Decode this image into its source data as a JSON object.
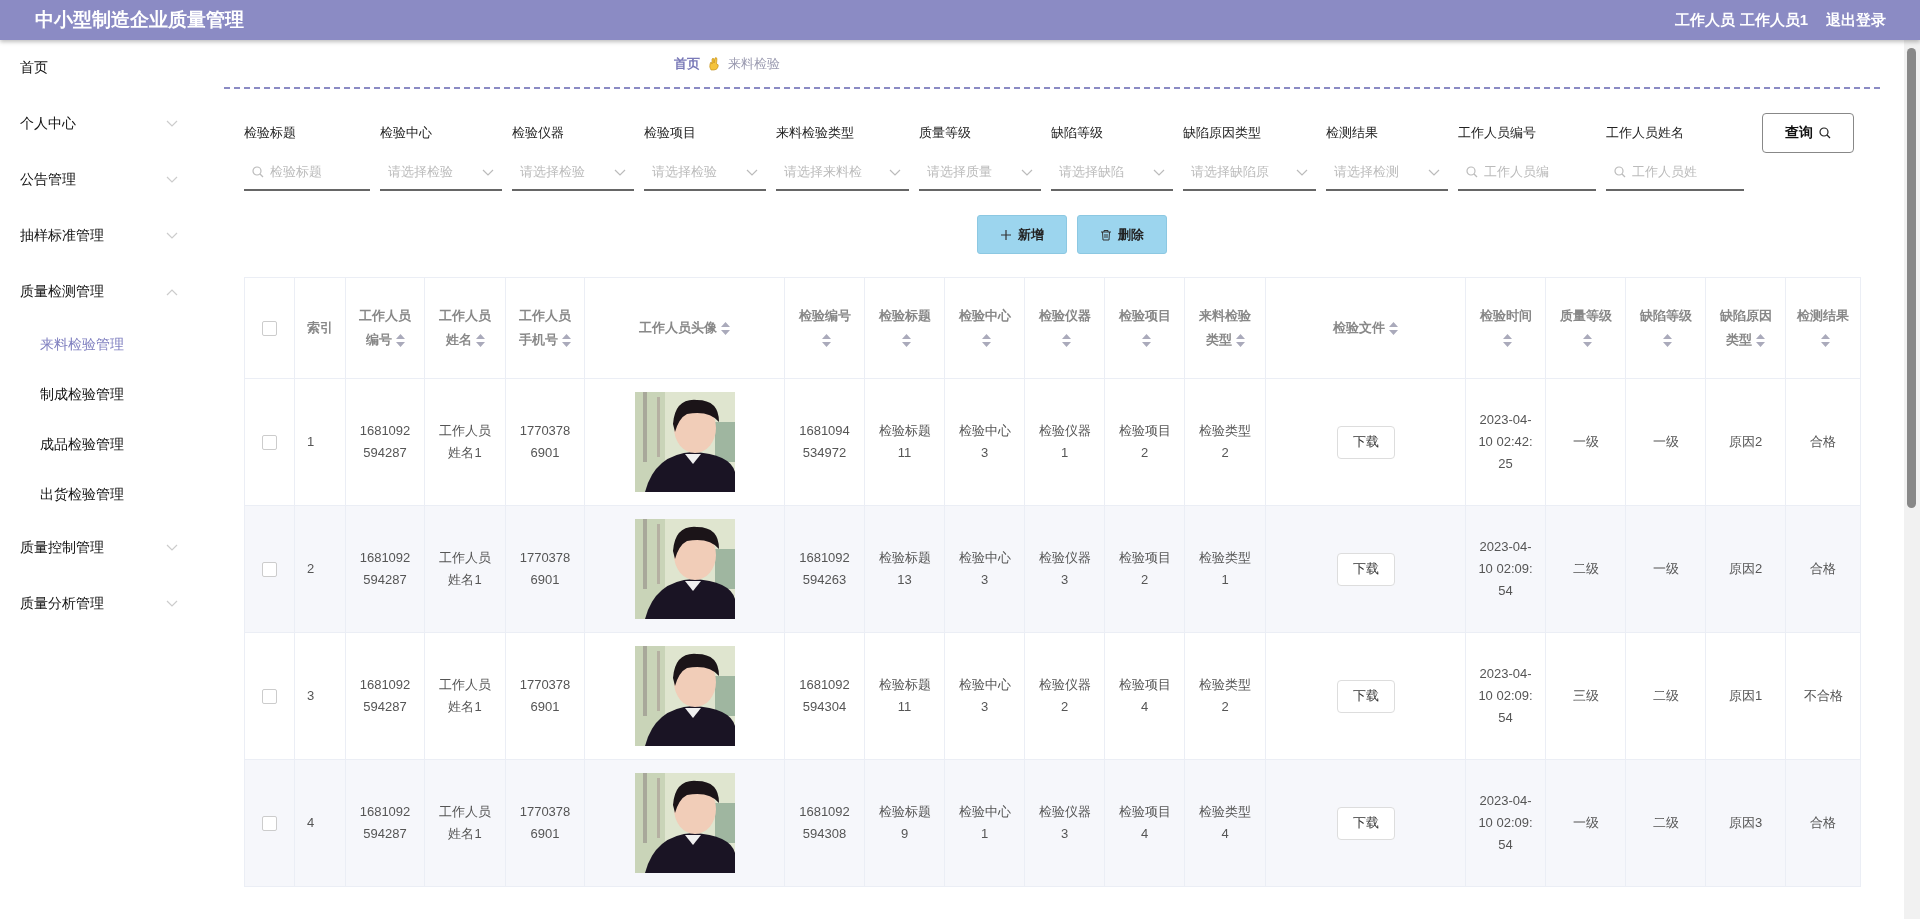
{
  "header": {
    "title": "中小型制造企业质量管理",
    "user": "工作人员 工作人员1",
    "logout": "退出登录"
  },
  "sidebar": {
    "items": [
      {
        "label": "首页",
        "kind": "link"
      },
      {
        "label": "个人中心",
        "kind": "menu",
        "expanded": false
      },
      {
        "label": "公告管理",
        "kind": "menu",
        "expanded": false
      },
      {
        "label": "抽样标准管理",
        "kind": "menu",
        "expanded": false
      },
      {
        "label": "质量检测管理",
        "kind": "menu",
        "expanded": true,
        "children": [
          {
            "label": "来料检验管理",
            "selected": true
          },
          {
            "label": "制成检验管理",
            "selected": false
          },
          {
            "label": "成品检验管理",
            "selected": false
          },
          {
            "label": "出货检验管理",
            "selected": false
          }
        ]
      },
      {
        "label": "质量控制管理",
        "kind": "menu",
        "expanded": false
      },
      {
        "label": "质量分析管理",
        "kind": "menu",
        "expanded": false
      }
    ]
  },
  "breadcrumb": {
    "home": "首页",
    "current": "来料检验"
  },
  "filters": [
    {
      "label": "检验标题",
      "kind": "search",
      "placeholder": "检验标题"
    },
    {
      "label": "检验中心",
      "kind": "select",
      "placeholder": "请选择检验"
    },
    {
      "label": "检验仪器",
      "kind": "select",
      "placeholder": "请选择检验"
    },
    {
      "label": "检验项目",
      "kind": "select",
      "placeholder": "请选择检验"
    },
    {
      "label": "来料检验类型",
      "kind": "select",
      "placeholder": "请选择来料检"
    },
    {
      "label": "质量等级",
      "kind": "select",
      "placeholder": "请选择质量"
    },
    {
      "label": "缺陷等级",
      "kind": "select",
      "placeholder": "请选择缺陷"
    },
    {
      "label": "缺陷原因类型",
      "kind": "select",
      "placeholder": "请选择缺陷原"
    },
    {
      "label": "检测结果",
      "kind": "select",
      "placeholder": "请选择检测"
    },
    {
      "label": "工作人员编号",
      "kind": "search",
      "placeholder": "工作人员编"
    },
    {
      "label": "工作人员姓名",
      "kind": "search",
      "placeholder": "工作人员姓"
    }
  ],
  "query_button": "查询",
  "actions": [
    {
      "label": "新增",
      "kind": "add"
    },
    {
      "label": "删除",
      "kind": "delete"
    }
  ],
  "table": {
    "select_all": {
      "checked": false
    },
    "columns": [
      {
        "label": "索引",
        "sortable": false
      },
      {
        "label": "工作人员编号",
        "sortable": true
      },
      {
        "label": "工作人员姓名",
        "sortable": true
      },
      {
        "label": "工作人员手机号",
        "sortable": true
      },
      {
        "label": "工作人员头像",
        "sortable": true
      },
      {
        "label": "检验编号",
        "sortable": true
      },
      {
        "label": "检验标题",
        "sortable": true
      },
      {
        "label": "检验中心",
        "sortable": true
      },
      {
        "label": "检验仪器",
        "sortable": true
      },
      {
        "label": "检验项目",
        "sortable": true
      },
      {
        "label": "来料检验类型",
        "sortable": true
      },
      {
        "label": "检验文件",
        "sortable": true
      },
      {
        "label": "检验时间",
        "sortable": true
      },
      {
        "label": "质量等级",
        "sortable": true
      },
      {
        "label": "缺陷等级",
        "sortable": true
      },
      {
        "label": "缺陷原因类型",
        "sortable": true
      },
      {
        "label": "检测结果",
        "sortable": true
      }
    ],
    "rows": [
      {
        "checked": false,
        "cells": [
          "1",
          "1681092594287",
          "工作人员姓名1",
          "17703786901",
          {
            "kind": "picture"
          },
          "1681094534972",
          "检验标题11",
          "检验中心3",
          "检验仪器1",
          "检验项目2",
          "检验类型2",
          {
            "kind": "button",
            "label": "下载"
          },
          "2023-04-10 02:42:25",
          "一级",
          "一级",
          "原因2",
          "合格"
        ]
      },
      {
        "checked": false,
        "cells": [
          "2",
          "1681092594287",
          "工作人员姓名1",
          "17703786901",
          {
            "kind": "picture"
          },
          "1681092594263",
          "检验标题13",
          "检验中心3",
          "检验仪器3",
          "检验项目2",
          "检验类型1",
          {
            "kind": "button",
            "label": "下载"
          },
          "2023-04-10 02:09:54",
          "二级",
          "一级",
          "原因2",
          "合格"
        ]
      },
      {
        "checked": false,
        "cells": [
          "3",
          "1681092594287",
          "工作人员姓名1",
          "17703786901",
          {
            "kind": "picture"
          },
          "1681092594304",
          "检验标题11",
          "检验中心3",
          "检验仪器2",
          "检验项目4",
          "检验类型2",
          {
            "kind": "button",
            "label": "下载"
          },
          "2023-04-10 02:09:54",
          "三级",
          "二级",
          "原因1",
          "不合格"
        ]
      },
      {
        "checked": false,
        "cells": [
          "4",
          "1681092594287",
          "工作人员姓名1",
          "17703786901",
          {
            "kind": "picture"
          },
          "1681092594308",
          "检验标题9",
          "检验中心1",
          "检验仪器3",
          "检验项目4",
          "检验类型4",
          {
            "kind": "button",
            "label": "下载"
          },
          "2023-04-10 02:09:54",
          "一级",
          "二级",
          "原因3",
          "合格"
        ]
      }
    ]
  }
}
